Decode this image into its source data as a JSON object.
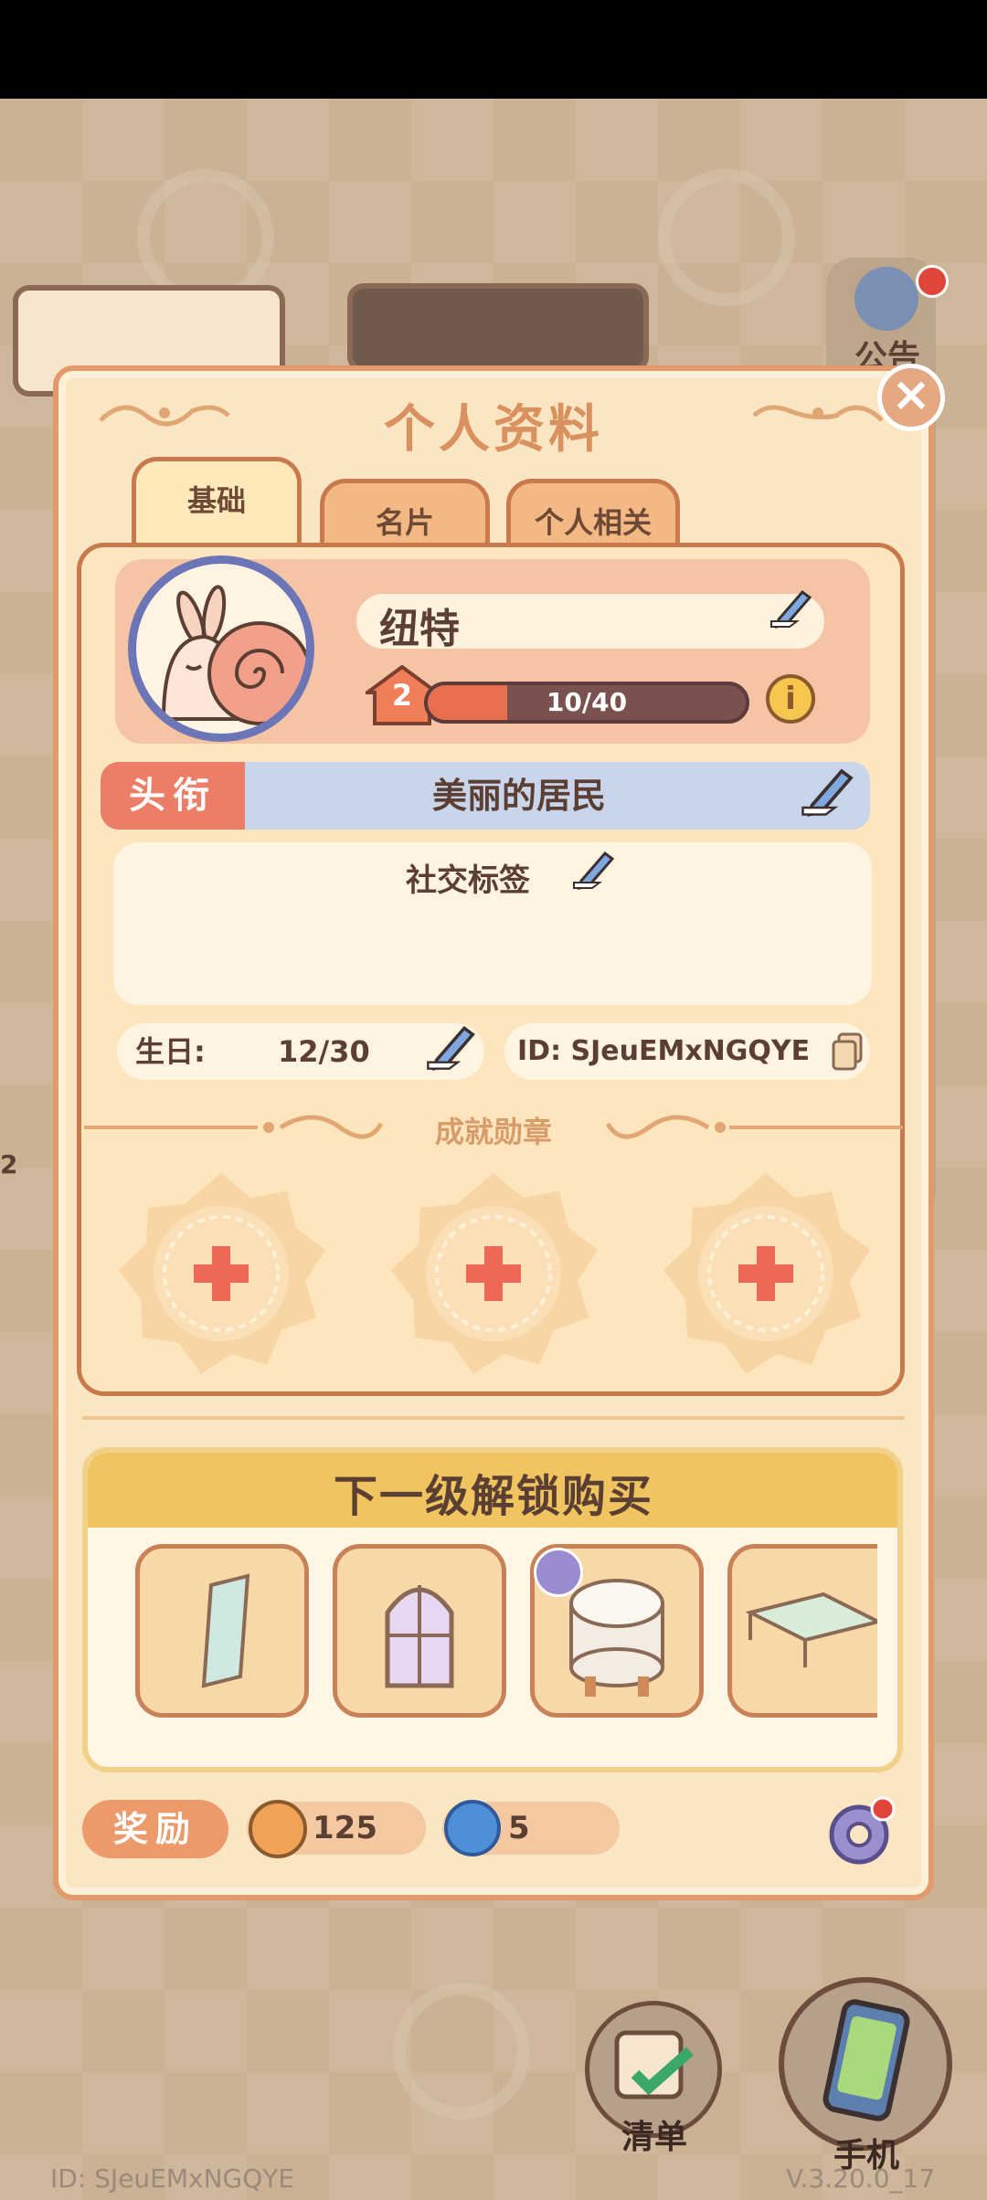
{
  "panel": {
    "title": "个人资料",
    "tabs": [
      {
        "label": "基础",
        "active": true
      },
      {
        "label": "名片",
        "active": false
      },
      {
        "label": "个人相关",
        "active": false
      }
    ]
  },
  "profile": {
    "name": "纽特",
    "level": "2",
    "xp_text": "10/40",
    "xp_fraction": 0.25,
    "title_label": "头衔",
    "title_value": "美丽的居民",
    "social_tag_label": "社交标签",
    "birthday_label": "生日:",
    "birthday_value": "12/30",
    "id_text": "ID: SJeuEMxNGQYE"
  },
  "achievements": {
    "label": "成就勋章",
    "slots": 3
  },
  "shop": {
    "title": "下一级解锁购买",
    "items": [
      "mirror-icon",
      "arched-window-icon",
      "round-stool-icon",
      "glass-table-icon"
    ]
  },
  "rewards": {
    "label": "奖励",
    "coins": "125",
    "spirals": "5"
  },
  "background": {
    "side_label": "公告",
    "checklist_label": "清单",
    "phone_label": "手机",
    "player_id": "ID: SJeuEMxNGQYE",
    "version": "V.3.20.0_17",
    "partial_number": "2"
  },
  "colors": {
    "accent": "#e39a6a",
    "panel_bg": "#fbe6c4",
    "title_bg": "#c8d5ea",
    "title_label_bg": "#ec7d66",
    "shop_header": "#f0c460"
  }
}
